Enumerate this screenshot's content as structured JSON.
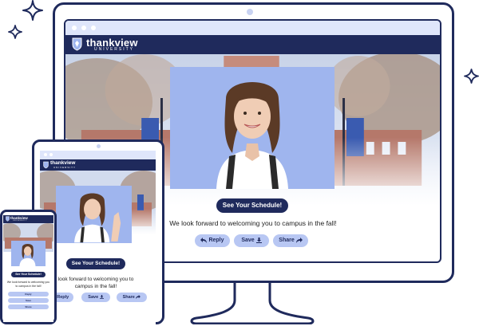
{
  "brand": {
    "name": "thankview",
    "subtitle": "UNIVERSITY"
  },
  "desktop": {
    "cta_label": "See Your Schedule!",
    "message": "We look forward to welcoming you to campus in the fall!",
    "buttons": {
      "reply": "Reply",
      "save": "Save",
      "share": "Share"
    }
  },
  "tablet": {
    "cta_label": "See Your Schedule!",
    "message": "look forward to welcoming you to campus in the fall!",
    "buttons": {
      "reply": "Reply",
      "save": "Save",
      "share": "Share"
    }
  },
  "phone": {
    "cta_label": "See Your Schedule!",
    "message": "We look forward to welcoming you to campus in the fall!",
    "buttons": {
      "reply": "Reply",
      "save": "Save",
      "share": "Share"
    }
  },
  "colors": {
    "navy": "#1f2a5c",
    "light_blue": "#b8c7f3",
    "video_bg": "#9fb5ee"
  }
}
